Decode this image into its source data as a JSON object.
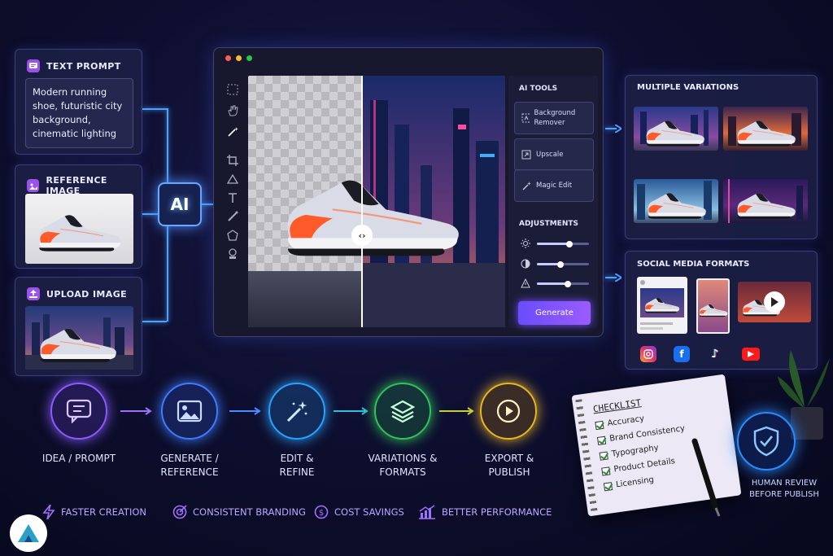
{
  "text_prompt": {
    "title": "TEXT PROMPT",
    "body": "Modern running shoe, futuristic city background, cinematic lighting"
  },
  "reference_image": {
    "title": "REFERENCE IMAGE"
  },
  "upload_image": {
    "title": "UPLOAD IMAGE"
  },
  "ai_chip": {
    "label": "AI"
  },
  "editor": {
    "ai_tools_heading": "AI TOOLS",
    "tools": [
      {
        "label": "Background Remover",
        "icon": "background-remover-icon"
      },
      {
        "label": "Upscale",
        "icon": "upscale-icon"
      },
      {
        "label": "Magic Edit",
        "icon": "magic-wand-icon"
      }
    ],
    "adjustments_heading": "ADJUSTMENTS",
    "adjustments": [
      {
        "name": "brightness",
        "value": 0.62
      },
      {
        "name": "contrast",
        "value": 0.45
      },
      {
        "name": "warning",
        "value": 0.6
      }
    ],
    "generate_label": "Generate"
  },
  "variations": {
    "title": "MULTIPLE VARIATIONS"
  },
  "social": {
    "title": "SOCIAL MEDIA FORMATS",
    "platforms": [
      "instagram",
      "facebook",
      "tiktok",
      "youtube"
    ],
    "tiktok_glyph": "♪"
  },
  "workflow": {
    "steps": [
      {
        "label": "IDEA / PROMPT",
        "color": "#8a5bff"
      },
      {
        "label": "GENERATE / REFERENCE",
        "color": "#3f7bff"
      },
      {
        "label": "EDIT & REFINE",
        "color": "#2aa2ff"
      },
      {
        "label": "VARIATIONS & FORMATS",
        "color": "#32c25a"
      },
      {
        "label": "EXPORT & PUBLISH",
        "color": "#e7b526"
      }
    ]
  },
  "checklist": {
    "title": "CHECKLIST",
    "items": [
      "Accuracy",
      "Brand Consistency",
      "Typography",
      "Product Details",
      "Licensing"
    ]
  },
  "human_review": {
    "label": "HUMAN REVIEW BEFORE PUBLISH"
  },
  "benefits": [
    {
      "label": "FASTER CREATION",
      "icon": "lightning-icon"
    },
    {
      "label": "CONSISTENT BRANDING",
      "icon": "target-icon"
    },
    {
      "label": "COST SAVINGS",
      "icon": "dollar-icon"
    },
    {
      "label": "BETTER PERFORMANCE",
      "icon": "chart-icon"
    }
  ],
  "colors": {
    "accent": "#7c4dff",
    "line": "#4da3ff",
    "shoe_sole": "#ff5a2a"
  }
}
